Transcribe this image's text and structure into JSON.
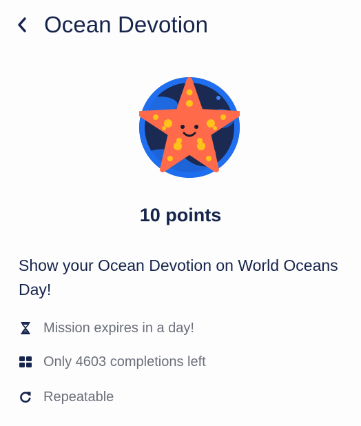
{
  "header": {
    "back_icon": "chevron-left-icon",
    "title": "Ocean Devotion"
  },
  "badge": {
    "icon": "starfish-icon",
    "colors": {
      "background": "#1a2a52",
      "ring": "#1f6ff0",
      "star": "#ff6b4a",
      "dots": "#ffc21a",
      "face": "#1a1a2e"
    }
  },
  "mission": {
    "points_text": "10 points",
    "description": "Show your Ocean Devotion on World Oceans Day!",
    "details": [
      {
        "icon": "hourglass-icon",
        "text": "Mission expires in a day!"
      },
      {
        "icon": "grid-icon",
        "text": "Only 4603 completions left"
      },
      {
        "icon": "repeat-icon",
        "text": "Repeatable"
      }
    ]
  }
}
